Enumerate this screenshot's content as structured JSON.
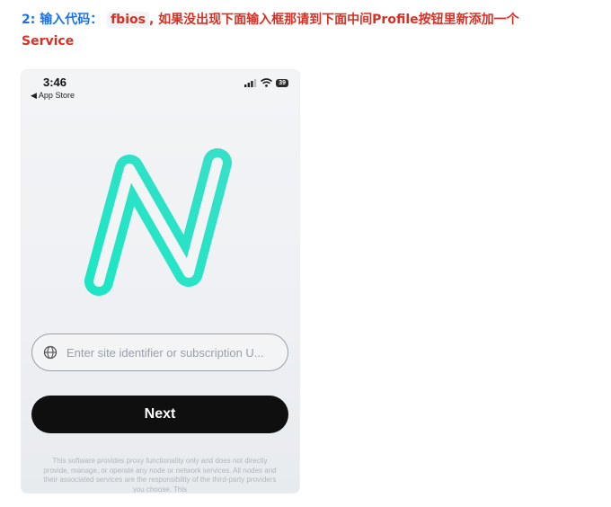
{
  "instruction": {
    "step_prefix": "2: 输入代码：",
    "code": "fbios",
    "message": ", 如果没出现下面输入框那请到下面中间Profile按钮里新添加一个 Service"
  },
  "phone": {
    "status_time": "3:46",
    "back_label": "◀ App Store",
    "battery": "39",
    "accent_color": "#28e3c1",
    "site_input": {
      "placeholder": "Enter site identifier or subscription U..."
    },
    "next_button": "Next",
    "disclaimer": "This software provides proxy functionality only and does not directly provide, manage, or operate any node or network services. All nodes and their associated services are the responsibility of the third-party providers you choose. This"
  }
}
